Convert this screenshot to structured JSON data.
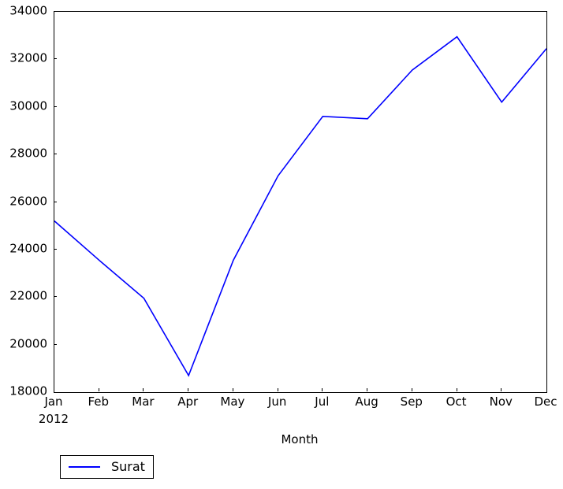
{
  "chart_data": {
    "type": "line",
    "title": "",
    "subtitle": "",
    "xlabel": "Month",
    "ylabel": "",
    "categories": [
      "Jan",
      "Feb",
      "Mar",
      "Apr",
      "May",
      "Jun",
      "Jul",
      "Aug",
      "Sep",
      "Oct",
      "Nov",
      "Dec"
    ],
    "x_subtick_labels": [
      "2012",
      "",
      "",
      "",
      "",
      "",
      "",
      "",
      "",
      "",
      "",
      ""
    ],
    "series": [
      {
        "name": "Surat",
        "color": "#0000ff",
        "values": [
          25200,
          23550,
          21950,
          18700,
          23550,
          27100,
          29600,
          29500,
          31550,
          32950,
          30200,
          32450
        ]
      }
    ],
    "ylim": [
      18000,
      34000
    ],
    "ytick_labels": [
      "18000",
      "20000",
      "22000",
      "24000",
      "26000",
      "28000",
      "30000",
      "32000",
      "34000"
    ],
    "ytick_values": [
      18000,
      20000,
      22000,
      24000,
      26000,
      28000,
      30000,
      32000,
      34000
    ],
    "grid": false,
    "legend_position": "below-axes-left",
    "legend_entries": [
      {
        "label": "Surat",
        "color": "#0000ff"
      }
    ]
  }
}
